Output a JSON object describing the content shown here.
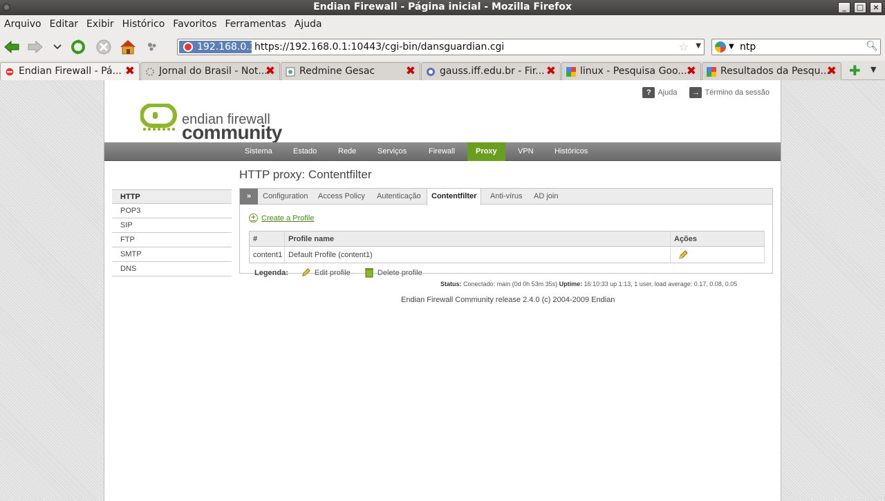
{
  "window": {
    "title": "Endian Firewall - Página inicial - Mozilla Firefox",
    "controls": [
      "_",
      "□",
      "×"
    ]
  },
  "menubar": [
    "Arquivo",
    "Editar",
    "Exibir",
    "Histórico",
    "Favoritos",
    "Ferramentas",
    "Ajuda"
  ],
  "address": {
    "site_identity": "192.168.0.1",
    "url": "https://192.168.0.1:10443/cgi-bin/dansguardian.cgi"
  },
  "search": {
    "value": "ntp"
  },
  "tabs": [
    {
      "label": "Endian Firewall - Pá...",
      "active": true
    },
    {
      "label": "Jornal do Brasil - Not...",
      "active": false
    },
    {
      "label": "Redmine Gesac",
      "active": false
    },
    {
      "label": "gauss.iff.edu.br - Fir...",
      "active": false
    },
    {
      "label": "linux - Pesquisa Goo...",
      "active": false
    },
    {
      "label": "Resultados da Pesqu...",
      "active": false
    }
  ],
  "page": {
    "toplinks": {
      "help": "Ajuda",
      "logout": "Término da sessão"
    },
    "logo": {
      "line1": "endian firewall",
      "line2": "community"
    },
    "mainnav": [
      "Sistema",
      "Estado",
      "Rede",
      "Serviços",
      "Firewall",
      "Proxy",
      "VPN",
      "Históricos"
    ],
    "mainnav_active": "Proxy",
    "title": "HTTP proxy: Contentfilter",
    "sidemenu": [
      "HTTP",
      "POP3",
      "SIP",
      "FTP",
      "SMTP",
      "DNS"
    ],
    "sidemenu_active": "HTTP",
    "panel_tabs": [
      "Configuration",
      "Access Policy",
      "Autenticação",
      "Contentfilter",
      "Anti-vírus",
      "AD join"
    ],
    "panel_tab_active": "Contentfilter",
    "create_link": "Create a Profile",
    "table": {
      "headers": [
        "#",
        "Profile name",
        "Ações"
      ],
      "rows": [
        {
          "id": "content1",
          "name": "Default Profile (content1)"
        }
      ]
    },
    "legend": {
      "label": "Legenda:",
      "edit": "Edit profile",
      "delete": "Delete profile"
    },
    "status": {
      "status_label": "Status:",
      "status_value": "Conectado: main (0d 0h 53m 35s)",
      "uptime_label": "Uptime:",
      "uptime_value": "16:10:33 up 1:13, 1 user, load average: 0.17, 0.08, 0.05"
    },
    "footer": "Endian Firewall Community release 2.4.0 (c) 2004-2009 Endian"
  },
  "colors": {
    "accent_green": "#6a9e1f",
    "nav_gray": "#7b7b7b",
    "url_highlight": "#5d7fb7"
  }
}
